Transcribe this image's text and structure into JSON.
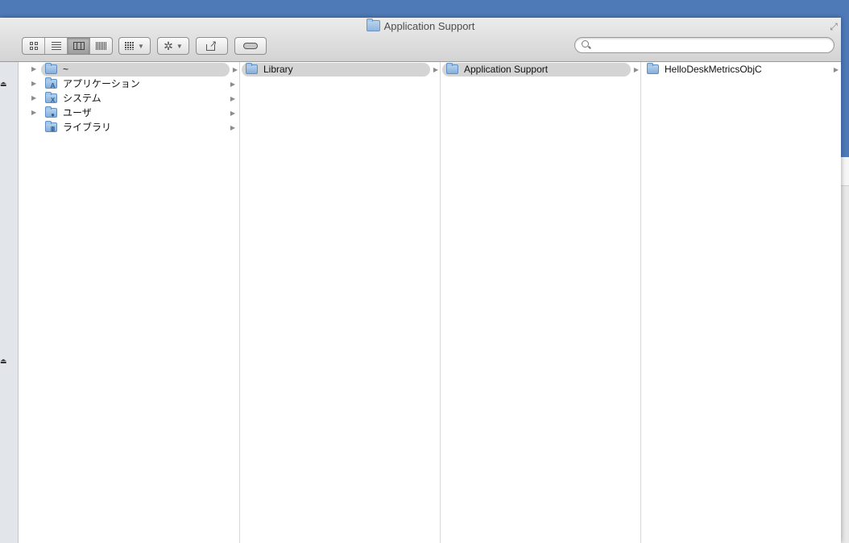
{
  "window": {
    "title": "Application Support"
  },
  "toolbar": {
    "view_buttons": [
      "icon-view",
      "list-view",
      "column-view",
      "cover-flow-view"
    ],
    "active_view": "column-view",
    "search": {
      "value": "",
      "placeholder": ""
    }
  },
  "sidebar": {
    "eject_symbol": "⏏"
  },
  "columns": [
    {
      "items": [
        {
          "label": "~",
          "icon": "folder-icon",
          "selected": true,
          "has_children": true
        },
        {
          "label": "アプリケーション",
          "icon": "applications-folder-icon",
          "selected": false,
          "has_children": true
        },
        {
          "label": "システム",
          "icon": "system-folder-icon",
          "selected": false,
          "has_children": true
        },
        {
          "label": "ユーザ",
          "icon": "users-folder-icon",
          "selected": false,
          "has_children": true
        },
        {
          "label": "ライブラリ",
          "icon": "library-folder-icon",
          "selected": false,
          "has_children": true
        }
      ]
    },
    {
      "items": [
        {
          "label": "Library",
          "icon": "folder-icon",
          "selected": true,
          "has_children": true
        }
      ]
    },
    {
      "items": [
        {
          "label": "Application Support",
          "icon": "folder-icon",
          "selected": true,
          "has_children": true
        }
      ]
    },
    {
      "items": [
        {
          "label": "HelloDeskMetricsObjC",
          "icon": "folder-icon",
          "selected": false,
          "has_children": true
        }
      ]
    }
  ]
}
